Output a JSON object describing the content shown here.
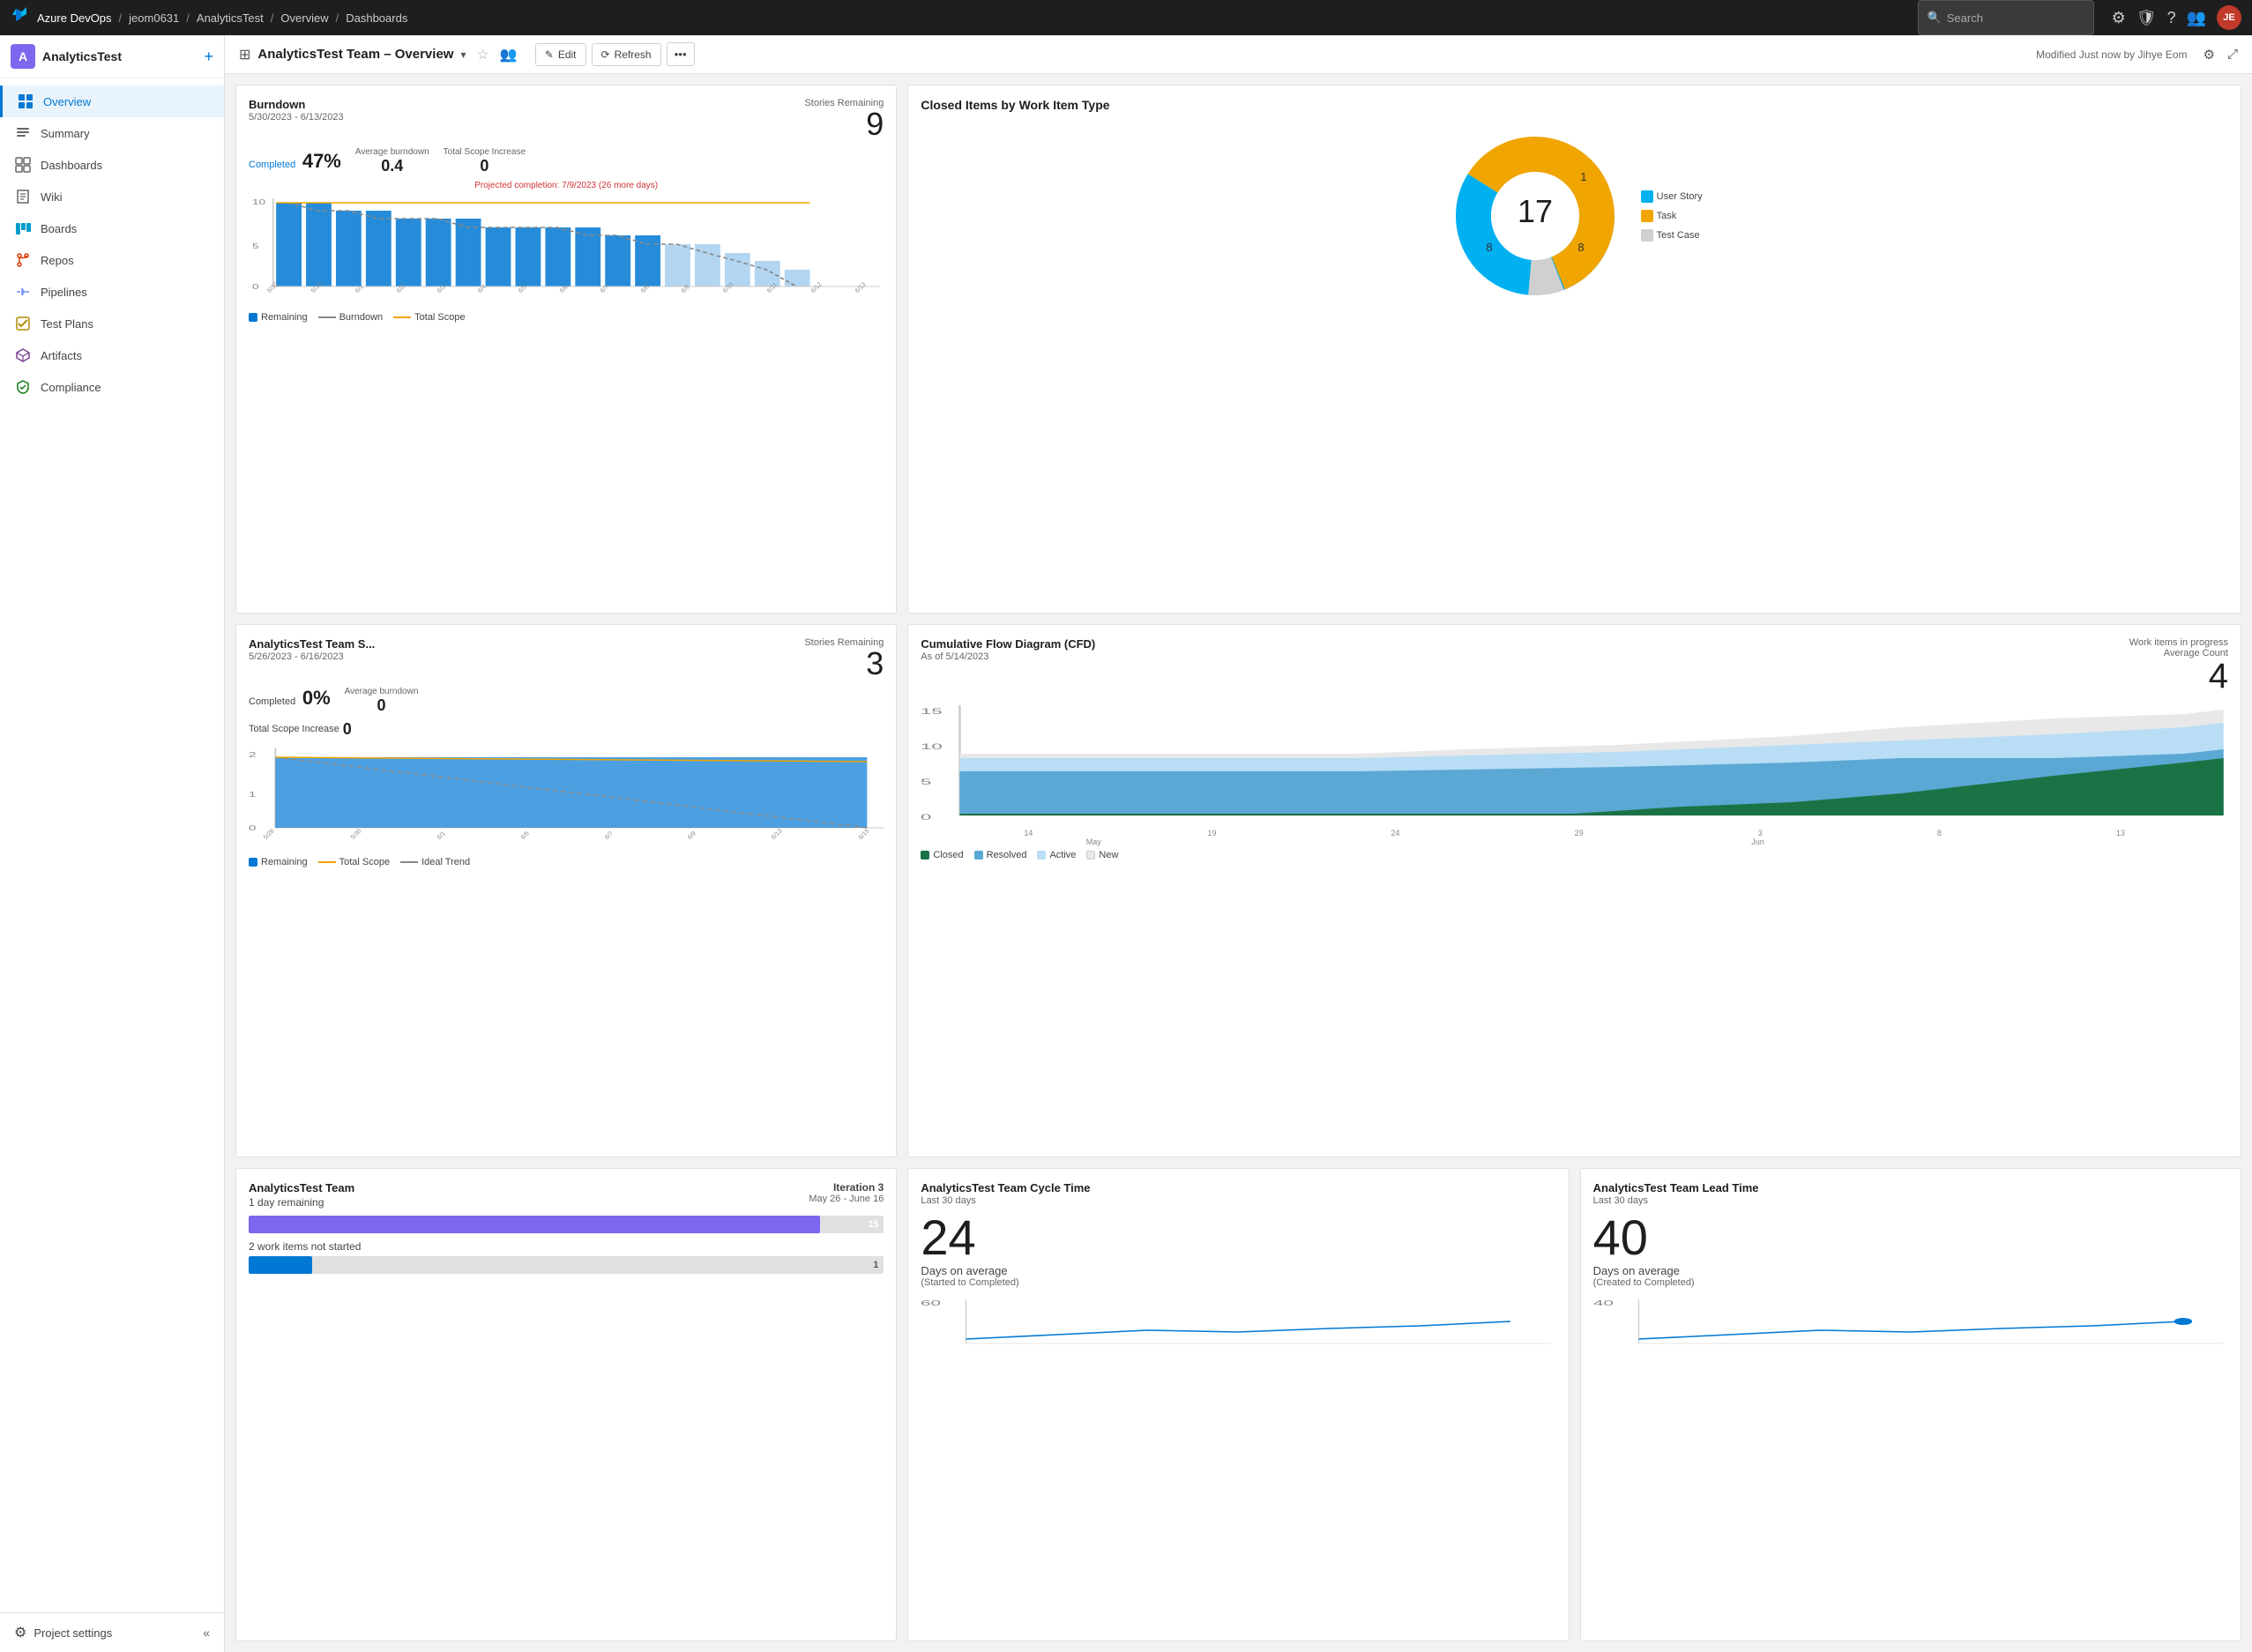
{
  "topnav": {
    "logo": "⬡",
    "org": "Azure DevOps",
    "breadcrumbs": [
      "jeom0631",
      "AnalyticsTest",
      "Overview",
      "Dashboards"
    ],
    "search_placeholder": "Search",
    "icons": [
      "☰",
      "🔒",
      "?",
      "👤"
    ]
  },
  "sidebar": {
    "org_name": "AnalyticsTest",
    "nav_items": [
      {
        "id": "overview",
        "label": "Overview",
        "icon": "🏠",
        "active": true
      },
      {
        "id": "summary",
        "label": "Summary",
        "icon": "📋",
        "active": false
      },
      {
        "id": "dashboards",
        "label": "Dashboards",
        "icon": "⊞",
        "active": false
      },
      {
        "id": "wiki",
        "label": "Wiki",
        "icon": "📖",
        "active": false
      },
      {
        "id": "boards",
        "label": "Boards",
        "icon": "☰",
        "active": false
      },
      {
        "id": "repos",
        "label": "Repos",
        "icon": "⑂",
        "active": false
      },
      {
        "id": "pipelines",
        "label": "Pipelines",
        "icon": "⟳",
        "active": false
      },
      {
        "id": "testplans",
        "label": "Test Plans",
        "icon": "✓",
        "active": false
      },
      {
        "id": "artifacts",
        "label": "Artifacts",
        "icon": "📦",
        "active": false
      },
      {
        "id": "compliance",
        "label": "Compliance",
        "icon": "🛡",
        "active": false
      }
    ],
    "footer": {
      "label": "Project settings",
      "collapse_icon": "«"
    }
  },
  "header": {
    "title": "AnalyticsTest Team – Overview",
    "edit_label": "Edit",
    "refresh_label": "Refresh",
    "modified_text": "Modified Just now by Jihye Eom"
  },
  "widgets": {
    "burndown": {
      "title": "Burndown",
      "date_range": "5/30/2023 - 6/13/2023",
      "completed_label": "Completed",
      "completed_value": "47%",
      "avg_burndown_label": "Average burndown",
      "avg_burndown_value": "0.4",
      "stories_remaining_label": "Stories Remaining",
      "stories_remaining_value": "9",
      "total_scope_label": "Total Scope Increase",
      "total_scope_value": "0",
      "projected_text": "Projected completion: 7/9/2023 (26 more days)",
      "legend": [
        {
          "label": "Remaining",
          "color": "#0078d4",
          "type": "square"
        },
        {
          "label": "Burndown",
          "color": "#888",
          "type": "line"
        },
        {
          "label": "Total Scope",
          "color": "#f0a500",
          "type": "line"
        }
      ],
      "bars": [
        10,
        10,
        9,
        9,
        8,
        8,
        8,
        7,
        7,
        7,
        7,
        6,
        6,
        5,
        5,
        4,
        3,
        2
      ]
    },
    "closed_items": {
      "title": "Closed Items by Work Item Type",
      "total": "17",
      "segments": [
        {
          "label": "User Story",
          "value": 8,
          "color": "#00b0f0"
        },
        {
          "label": "Task",
          "value": 8,
          "color": "#f0a500"
        },
        {
          "label": "Test Case",
          "value": 1,
          "color": "#ccc"
        }
      ],
      "labels_on_chart": [
        "1",
        "8",
        "8"
      ]
    },
    "sprint": {
      "title": "AnalyticsTest Team S...",
      "date_range": "5/26/2023 - 6/16/2023",
      "completed_label": "Completed",
      "completed_value": "0%",
      "avg_burndown_label": "Average burndown",
      "avg_burndown_value": "0",
      "stories_remaining_label": "Stories Remaining",
      "stories_remaining_value": "3",
      "total_scope_label": "Total Scope Increase",
      "total_scope_value": "0",
      "legend": [
        {
          "label": "Remaining",
          "color": "#0078d4",
          "type": "square"
        },
        {
          "label": "Total Scope",
          "color": "#f0a500",
          "type": "line"
        },
        {
          "label": "Ideal Trend",
          "color": "#888",
          "type": "line"
        }
      ]
    },
    "cfd": {
      "title": "Cumulative Flow Diagram (CFD)",
      "subtitle": "As of 5/14/2023",
      "work_items_label": "Work items in progress",
      "avg_count_label": "Average Count",
      "avg_count_value": "4",
      "x_labels": [
        "14",
        "19",
        "24",
        "29",
        "3",
        "8",
        "13"
      ],
      "x_label_months": [
        "May",
        "Jun"
      ],
      "legend": [
        {
          "label": "Closed",
          "color": "#1a7345"
        },
        {
          "label": "Resolved",
          "color": "#2980b9"
        },
        {
          "label": "Active",
          "color": "#a8d8f0"
        },
        {
          "label": "New",
          "color": "#e0e0e0"
        }
      ]
    },
    "iteration": {
      "title": "AnalyticsTest Team",
      "iteration_label": "Iteration 3",
      "date_range": "May 26 - June 16",
      "day_remaining": "1 day remaining",
      "progress_bar_value": 15,
      "work_items_not_started": "2 work items not started",
      "not_started_value": 1
    },
    "cycle_time": {
      "title": "AnalyticsTest Team Cycle Time",
      "subtitle": "Last 30 days",
      "value": "24",
      "unit_label": "Days on average",
      "desc": "(Started to Completed)",
      "chart_max": 60
    },
    "lead_time": {
      "title": "AnalyticsTest Team Lead Time",
      "subtitle": "Last 30 days",
      "value": "40",
      "unit_label": "Days on average",
      "desc": "(Created to Completed)",
      "chart_max": 40,
      "color": "#0078d4"
    }
  }
}
